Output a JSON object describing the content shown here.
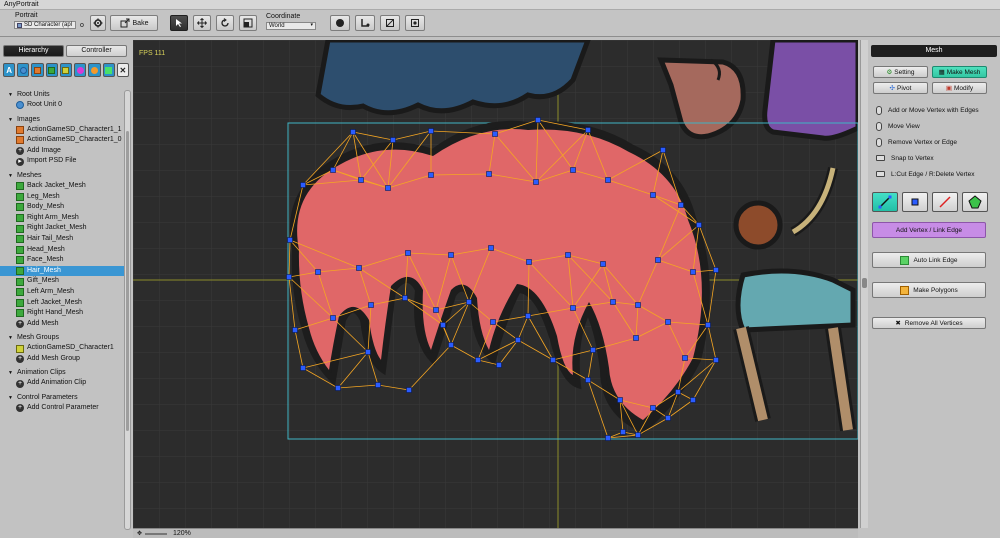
{
  "app": {
    "title": "AnyPortrait"
  },
  "toolbar": {
    "portrait_label": "Portrait",
    "portrait_value": "SD Character (apl",
    "portrait_suffix": "o",
    "bake_label": "Bake",
    "coordinate_label": "Coordinate",
    "coordinate_value": "World"
  },
  "hierarchy": {
    "tabs": [
      "Hierarchy",
      "Controller"
    ],
    "active_tab": "Hierarchy",
    "filter_first_label": "A",
    "sections": {
      "root_units": {
        "title": "Root Units",
        "items": [
          "Root Unit 0"
        ]
      },
      "images": {
        "title": "Images",
        "items": [
          "ActionGameSD_Character1_1",
          "ActionGameSD_Character1_0"
        ],
        "add": [
          "Add Image",
          "Import PSD File"
        ]
      },
      "meshes": {
        "title": "Meshes",
        "items": [
          "Back Jacket_Mesh",
          "Leg_Mesh",
          "Body_Mesh",
          "Right Arm_Mesh",
          "Right Jacket_Mesh",
          "Hair Tail_Mesh",
          "Head_Mesh",
          "Face_Mesh",
          "Hair_Mesh",
          "Gift_Mesh",
          "Left Arm_Mesh",
          "Left Jacket_Mesh",
          "Right Hand_Mesh"
        ],
        "selected": "Hair_Mesh",
        "add": "Add Mesh"
      },
      "mesh_groups": {
        "title": "Mesh Groups",
        "items": [
          "ActionGameSD_Character1"
        ],
        "add": "Add Mesh Group"
      },
      "animation_clips": {
        "title": "Animation Clips",
        "add": "Add Animation Clip"
      },
      "control_parameters": {
        "title": "Control Parameters",
        "add": "Add Control Parameter"
      }
    }
  },
  "viewport": {
    "fps": "FPS 111",
    "zoom": "120%",
    "colors": {
      "bg": "#2c2c2c",
      "hair": "#e06768",
      "edge": "#f5a623",
      "vertex": "#2a5cff"
    }
  },
  "mesh_panel": {
    "title": "Mesh",
    "buttons": {
      "setting": "Setting",
      "make_mesh": "Make Mesh",
      "pivot": "Pivot",
      "modify": "Modify"
    },
    "hints": [
      "Add or Move Vertex with Edges",
      "Move View",
      "Remove Vertex or Edge",
      "Snap to Vertex",
      "L:Cut Edge / R:Delete Vertex"
    ],
    "add_vertex_link": "Add Vertex / Link Edge",
    "auto_link": "Auto Link Edge",
    "make_polygons": "Make Polygons",
    "remove_all": "Remove All Vertices"
  }
}
